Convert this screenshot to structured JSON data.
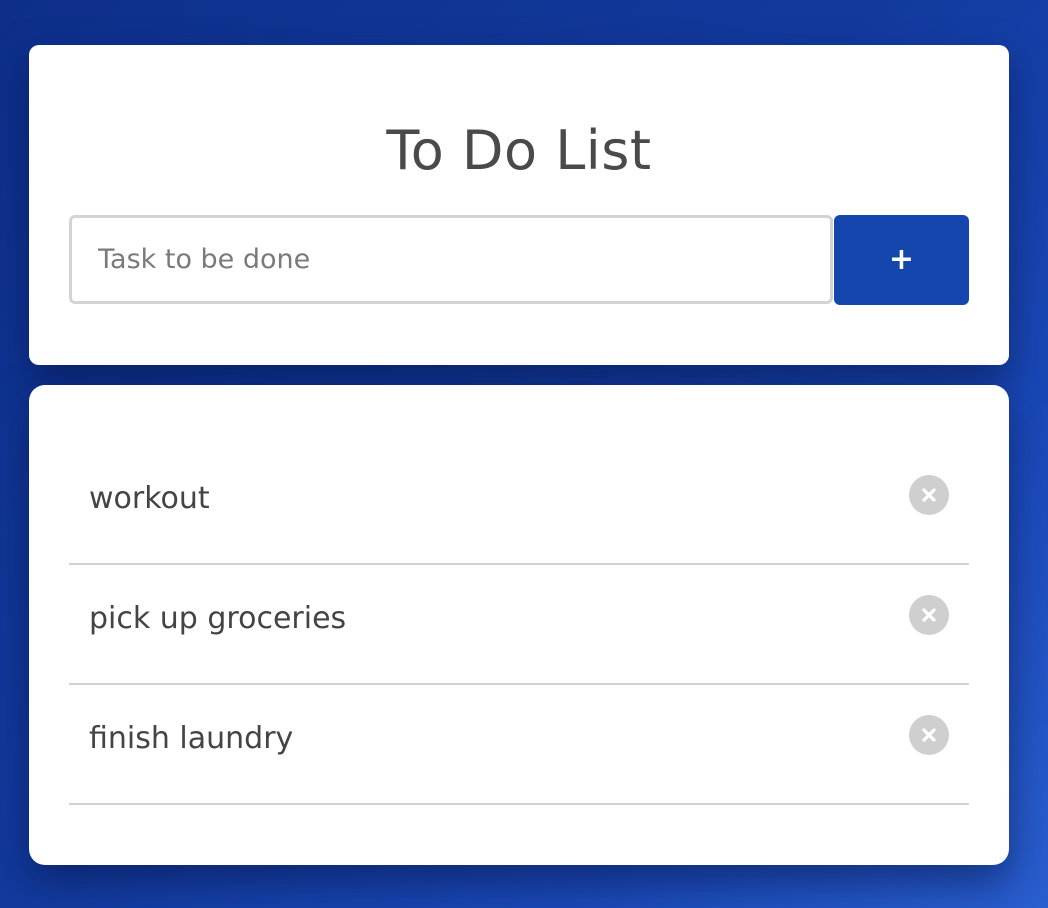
{
  "app": {
    "title": "To Do List"
  },
  "input": {
    "placeholder": "Task to be done",
    "value": ""
  },
  "add_button": {
    "label": "+"
  },
  "tasks": [
    {
      "label": "workout",
      "delete_icon": "close-circle-icon"
    },
    {
      "label": "pick up groceries",
      "delete_icon": "close-circle-icon"
    },
    {
      "label": "finish laundry",
      "delete_icon": "close-circle-icon"
    }
  ],
  "colors": {
    "accent": "#1446ad",
    "background_start": "#0d2f8a",
    "background_end": "#2a5fd0",
    "delete_icon_bg": "#cfcfcf",
    "text": "#444444"
  }
}
